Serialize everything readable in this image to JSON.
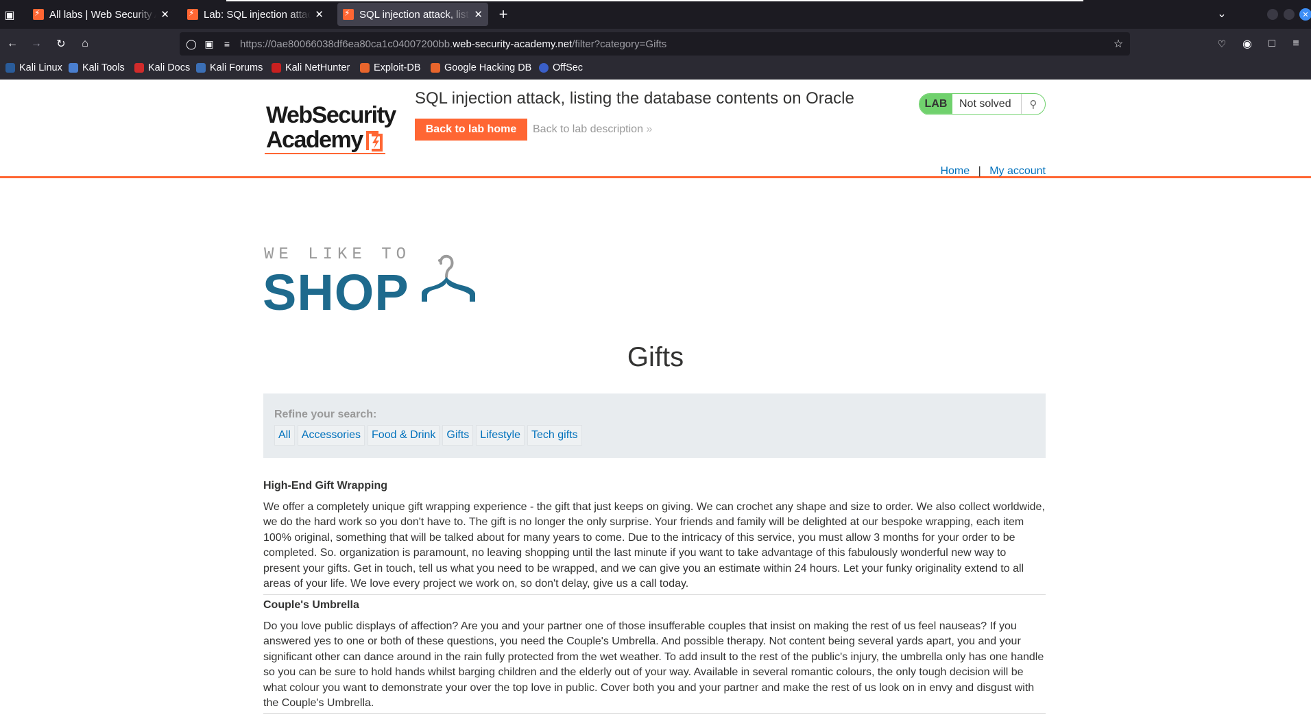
{
  "browser": {
    "tabs": [
      {
        "title": "All labs | Web Security Academy",
        "active": false
      },
      {
        "title": "Lab: SQL injection attack, listing the database contents on Oracle",
        "active": false
      },
      {
        "title": "SQL injection attack, listing the database contents on Oracle",
        "active": true
      }
    ],
    "url_prefix": "https://0ae80066038df6ea80ca1c04007200bb.",
    "url_host": "web-security-academy.net",
    "url_path": "/filter?category=Gifts",
    "bookmarks": [
      {
        "label": "Kali Linux",
        "color": "#2a5c9a"
      },
      {
        "label": "Kali Tools",
        "color": "#4a7fd0"
      },
      {
        "label": "Kali Docs",
        "color": "#d12b2b"
      },
      {
        "label": "Kali Forums",
        "color": "#3b6fb6"
      },
      {
        "label": "Kali NetHunter",
        "color": "#c82020"
      },
      {
        "label": "Exploit-DB",
        "color": "#e8652c"
      },
      {
        "label": "Google Hacking DB",
        "color": "#e8652c"
      },
      {
        "label": "OffSec",
        "color": "#3a5fc8"
      }
    ]
  },
  "lab_header": {
    "logo_line1": "WebSecurity",
    "logo_line2": "Academy",
    "title": "SQL injection attack, listing the database contents on Oracle",
    "back_home": "Back to lab home",
    "back_desc": "Back to lab description",
    "badge": "LAB",
    "status": "Not solved",
    "accent_color": "#ff6633",
    "status_color": "#70d16d"
  },
  "nav": {
    "home": "Home",
    "separator": "|",
    "account": "My account"
  },
  "shop_logo": {
    "tagline": "WE LIKE TO",
    "word": "SHOP"
  },
  "heading": "Gifts",
  "filter": {
    "label": "Refine your search:",
    "categories": [
      "All",
      "Accessories",
      "Food & Drink",
      "Gifts",
      "Lifestyle",
      "Tech gifts"
    ]
  },
  "products": [
    {
      "name": "High-End Gift Wrapping",
      "description": "We offer a completely unique gift wrapping experience - the gift that just keeps on giving. We can crochet any shape and size to order. We also collect worldwide, we do the hard work so you don't have to. The gift is no longer the only surprise. Your friends and family will be delighted at our bespoke wrapping, each item 100% original, something that will be talked about for many years to come. Due to the intricacy of this service, you must allow 3 months for your order to be completed. So. organization is paramount, no leaving shopping until the last minute if you want to take advantage of this fabulously wonderful new way to present your gifts. Get in touch, tell us what you need to be wrapped, and we can give you an estimate within 24 hours. Let your funky originality extend to all areas of your life. We love every project we work on, so don't delay, give us a call today."
    },
    {
      "name": "Couple's Umbrella",
      "description": "Do you love public displays of affection? Are you and your partner one of those insufferable couples that insist on making the rest of us feel nauseas? If you answered yes to one or both of these questions, you need the Couple's Umbrella. And possible therapy. Not content being several yards apart, you and your significant other can dance around in the rain fully protected from the wet weather. To add insult to the rest of the public's injury, the umbrella only has one handle so you can be sure to hold hands whilst barging children and the elderly out of your way. Available in several romantic colours, the only tough decision will be what colour you want to demonstrate your over the top love in public. Cover both you and your partner and make the rest of us look on in envy and disgust with the Couple's Umbrella."
    }
  ]
}
